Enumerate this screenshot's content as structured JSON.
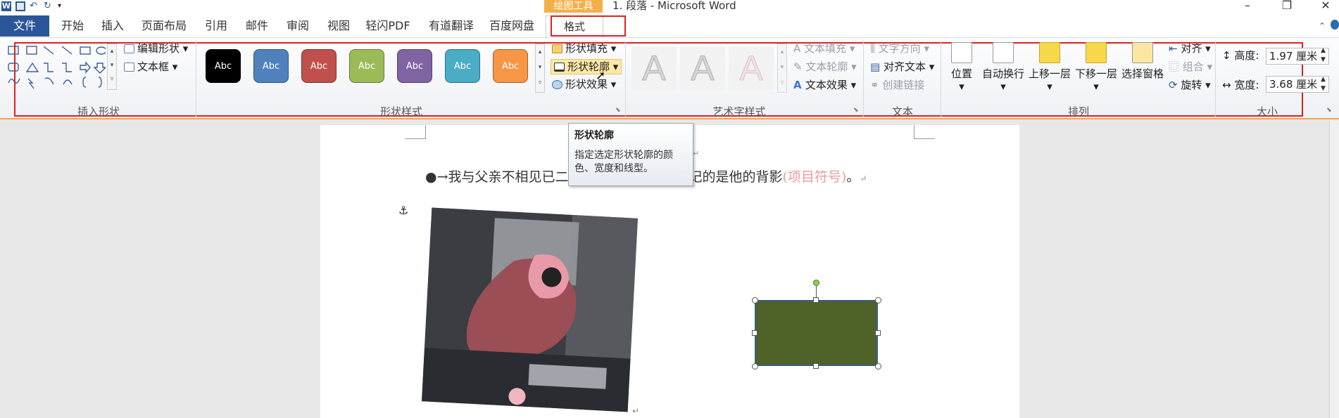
{
  "titlebar": {
    "app_icon": "W",
    "context_tab_header": "绘图工具",
    "document_title": "1. 段落 - Microsoft Word"
  },
  "tabs": {
    "file": "文件",
    "items": [
      "开始",
      "插入",
      "页面布局",
      "引用",
      "邮件",
      "审阅",
      "视图",
      "轻闪PDF",
      "有道翻译",
      "百度网盘"
    ],
    "format": "格式"
  },
  "ribbon": {
    "insert_shapes": {
      "edit_shape": "编辑形状",
      "text_box": "文本框",
      "label": "插入形状"
    },
    "shape_styles": {
      "swatches": [
        {
          "text": "Abc",
          "color": "#000000"
        },
        {
          "text": "Abc",
          "color": "#4f81bd"
        },
        {
          "text": "Abc",
          "color": "#c0504d"
        },
        {
          "text": "Abc",
          "color": "#9bbb59"
        },
        {
          "text": "Abc",
          "color": "#8064a2"
        },
        {
          "text": "Abc",
          "color": "#4bacc6"
        },
        {
          "text": "Abc",
          "color": "#f79646"
        }
      ],
      "fill": "形状填充",
      "outline": "形状轮廓",
      "effects": "形状效果",
      "label": "形状样式"
    },
    "wordart": {
      "sample": "A",
      "text_fill": "文本填充",
      "text_outline": "文本轮廓",
      "text_effects": "文本效果",
      "label": "艺术字样式"
    },
    "text": {
      "direction": "文字方向",
      "align_text": "对齐文本",
      "create_link": "创建链接",
      "label": "文本"
    },
    "arrange": {
      "position": "位置",
      "wrap": "自动换行",
      "bring_forward": "上移一层",
      "send_backward": "下移一层",
      "selection_pane": "选择窗格",
      "align": "对齐",
      "group": "组合",
      "rotate": "旋转",
      "label": "排列"
    },
    "size": {
      "height_label": "高度:",
      "height_value": "1.97 厘米",
      "width_label": "宽度:",
      "width_value": "3.68 厘米",
      "label": "大小"
    }
  },
  "tooltip": {
    "title": "形状轮廓",
    "description": "指定选定形状轮廓的颜色、宽度和线型。"
  },
  "document": {
    "bullet_text": "我与父亲不相见已二年余了，我最不能忘记的是他的背影",
    "bullet_note": "(项目符号)",
    "bullet_end": "。"
  },
  "colors": {
    "accent_orange": "#f4a44a",
    "file_tab": "#2a5699",
    "highlight_red": "#e02020",
    "shape_fill": "#4f6228"
  }
}
